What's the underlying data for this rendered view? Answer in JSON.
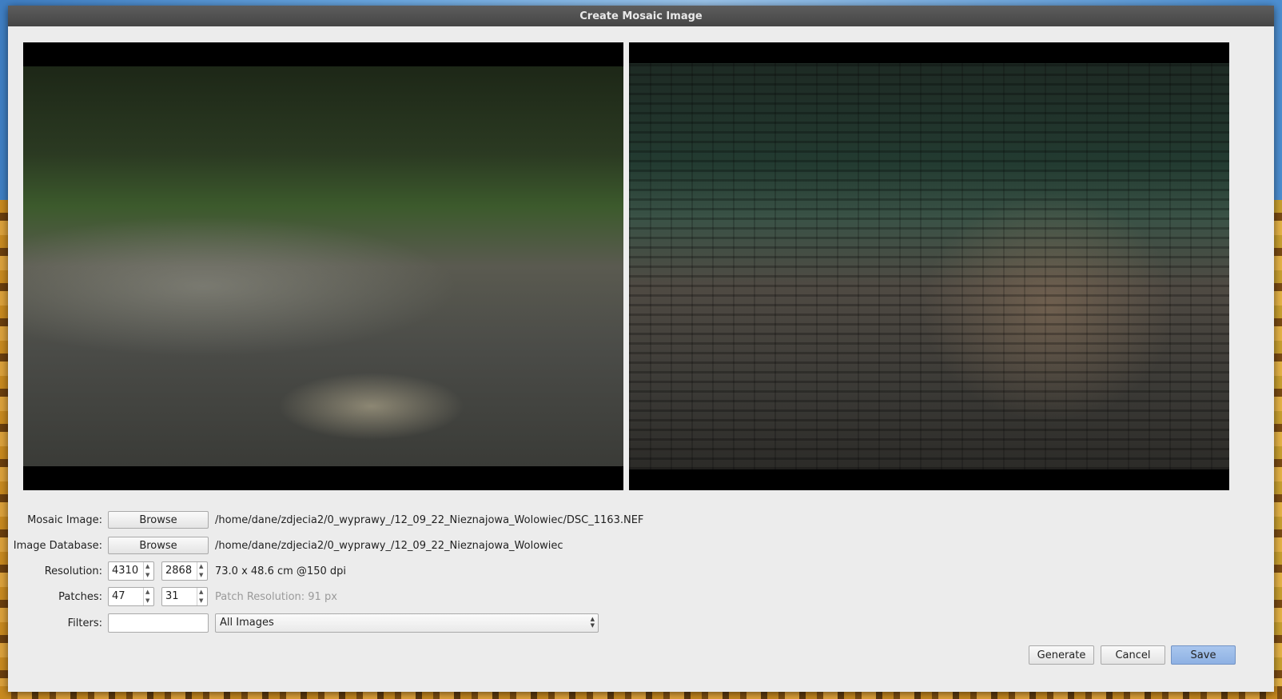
{
  "window": {
    "title": "Create Mosaic Image"
  },
  "previews": {
    "original": {
      "alt": "original-photo"
    },
    "mosaic": {
      "alt": "mosaic-result"
    }
  },
  "form": {
    "mosaic_image": {
      "label": "Mosaic Image:",
      "button": "Browse",
      "path": "/home/dane/zdjecia2/0_wyprawy_/12_09_22_Nieznajowa_Wolowiec/DSC_1163.NEF"
    },
    "image_database": {
      "label": "Image Database:",
      "button": "Browse",
      "path": "/home/dane/zdjecia2/0_wyprawy_/12_09_22_Nieznajowa_Wolowiec"
    },
    "resolution": {
      "label": "Resolution:",
      "width": "4310",
      "height": "2868",
      "info": "73.0 x 48.6 cm @150 dpi"
    },
    "patches": {
      "label": "Patches:",
      "cols": "47",
      "rows": "31",
      "info": "Patch Resolution: 91 px"
    },
    "filters": {
      "label": "Filters:",
      "value": "",
      "select_value": "All Images"
    }
  },
  "buttons": {
    "generate": "Generate",
    "cancel": "Cancel",
    "save": "Save"
  }
}
